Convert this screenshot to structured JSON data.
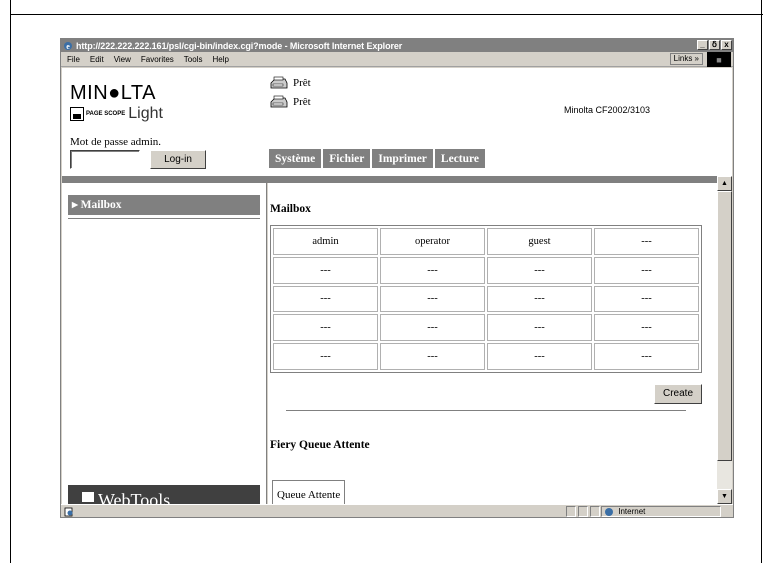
{
  "browser": {
    "title": "http://222.222.222.161/psl/cgi-bin/index.cgi?mode - Microsoft Internet Explorer",
    "controls": {
      "minimize": "_",
      "restore": "ẟ",
      "close": "x"
    },
    "menu": [
      "File",
      "Edit",
      "View",
      "Favorites",
      "Tools",
      "Help"
    ],
    "links_label": "Links »",
    "status_zone": "Internet"
  },
  "header": {
    "brand": "MIN●LTA",
    "pagescope_badge": "PAGE SCOPE",
    "pagescope_product": "Light",
    "password_label": "Mot de passe admin.",
    "password_value": "",
    "login_label": "Log-in",
    "status": [
      "Prêt",
      "Prêt"
    ],
    "model": "Minolta CF2002/3103",
    "tabs": [
      "Système",
      "Fichier",
      "Imprimer",
      "Lecture"
    ]
  },
  "sidebar": {
    "mailbox_label": "▸ Mailbox",
    "webtools_label": "WebTools"
  },
  "main": {
    "mailbox_title": "Mailbox",
    "mailbox_rows": [
      [
        "admin",
        "operator",
        "guest",
        "---"
      ],
      [
        "---",
        "---",
        "---",
        "---"
      ],
      [
        "---",
        "---",
        "---",
        "---"
      ],
      [
        "---",
        "---",
        "---",
        "---"
      ],
      [
        "---",
        "---",
        "---",
        "---"
      ]
    ],
    "create_label": "Create",
    "queue_title": "Fiery Queue Attente",
    "queue_tab": "Queue Attente"
  },
  "colors": {
    "accent_gray": "#808080",
    "window_face": "#d4d0c8"
  }
}
